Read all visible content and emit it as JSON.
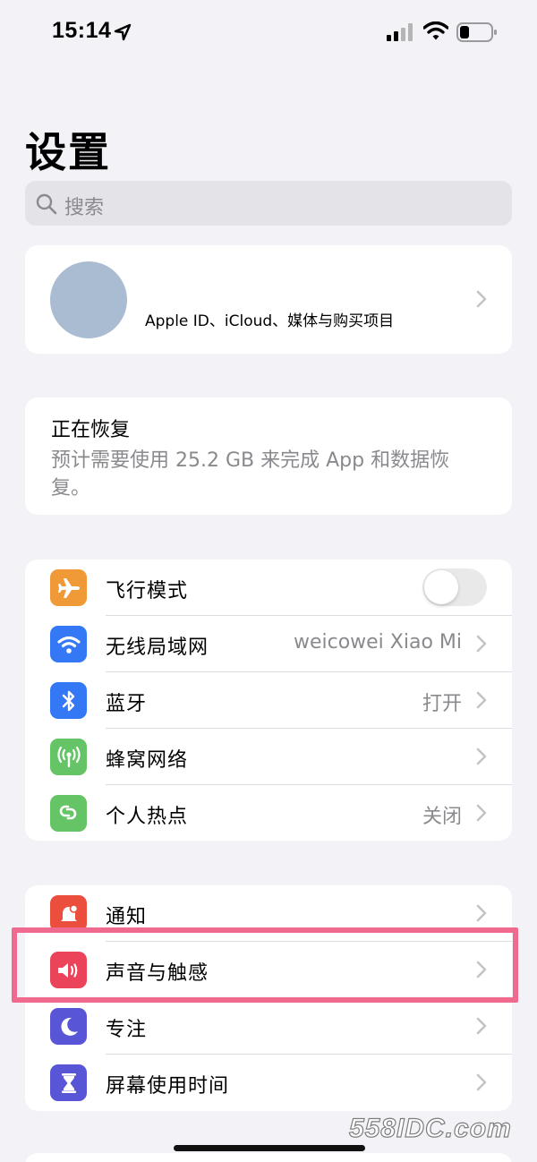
{
  "status_bar": {
    "time": "15:14"
  },
  "header": {
    "title": "设置",
    "search_placeholder": "搜索"
  },
  "profile": {
    "subtitle": "Apple ID、iCloud、媒体与购买项目"
  },
  "restore": {
    "title": "正在恢复",
    "description": "预计需要使用 25.2 GB 来完成 App 和数据恢复。"
  },
  "group1": [
    {
      "label": "飞行模式",
      "value": "",
      "icon": "airplane-icon",
      "color": "#f09a37",
      "toggle": false
    },
    {
      "label": "无线局域网",
      "value": "weicowei Xiao Mi",
      "icon": "wifi-icon",
      "color": "#3478f6"
    },
    {
      "label": "蓝牙",
      "value": "打开",
      "icon": "bluetooth-icon",
      "color": "#3478f6"
    },
    {
      "label": "蜂窝网络",
      "value": "",
      "icon": "antenna-icon",
      "color": "#65c466"
    },
    {
      "label": "个人热点",
      "value": "关闭",
      "icon": "hotspot-icon",
      "color": "#65c466"
    }
  ],
  "group2": [
    {
      "label": "通知",
      "icon": "bell-icon",
      "color": "#eb4e3d"
    },
    {
      "label": "声音与触感",
      "icon": "speaker-icon",
      "color": "#eb445a"
    },
    {
      "label": "专注",
      "icon": "moon-icon",
      "color": "#5856d6"
    },
    {
      "label": "屏幕使用时间",
      "icon": "hourglass-icon",
      "color": "#5856d6"
    }
  ],
  "highlight_color": "#f06a90",
  "watermark": "558IDC.com"
}
